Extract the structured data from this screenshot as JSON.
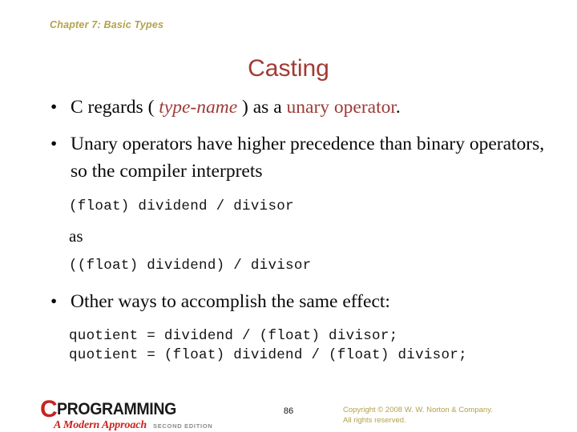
{
  "header": {
    "chapter": "Chapter 7: Basic Types"
  },
  "title": "Casting",
  "colors": {
    "header_olive": "#b3a14a",
    "title_red": "#a23a33",
    "accent_red": "#9e3b38",
    "logo_red": "#c9221f",
    "body_black": "#0a0a0a"
  },
  "content": {
    "bullet1": {
      "part1": "C regards ",
      "paren_open": "( ",
      "type_name": "type-name",
      "paren_close": " )",
      "part2": " as a ",
      "emphasis": "unary operator",
      "part3": "."
    },
    "bullet2": "Unary operators have higher precedence than binary operators, so the compiler interprets",
    "code1": "(float) dividend / divisor",
    "as_word": "as",
    "code2": "((float) dividend) / divisor",
    "bullet3": "Other ways to accomplish the same effect:",
    "code3_line1": "quotient = dividend / (float) divisor;",
    "code3_line2": "quotient = (float) dividend / (float) divisor;",
    "bullet_glyph": "•"
  },
  "footer": {
    "logo": {
      "letter_c": "C",
      "word": "PROGRAMMING",
      "subtitle": "A Modern Approach",
      "edition": "SECOND EDITION"
    },
    "page_number": "86",
    "copyright_line1": "Copyright © 2008 W. W. Norton & Company.",
    "copyright_line2": "All rights reserved."
  }
}
